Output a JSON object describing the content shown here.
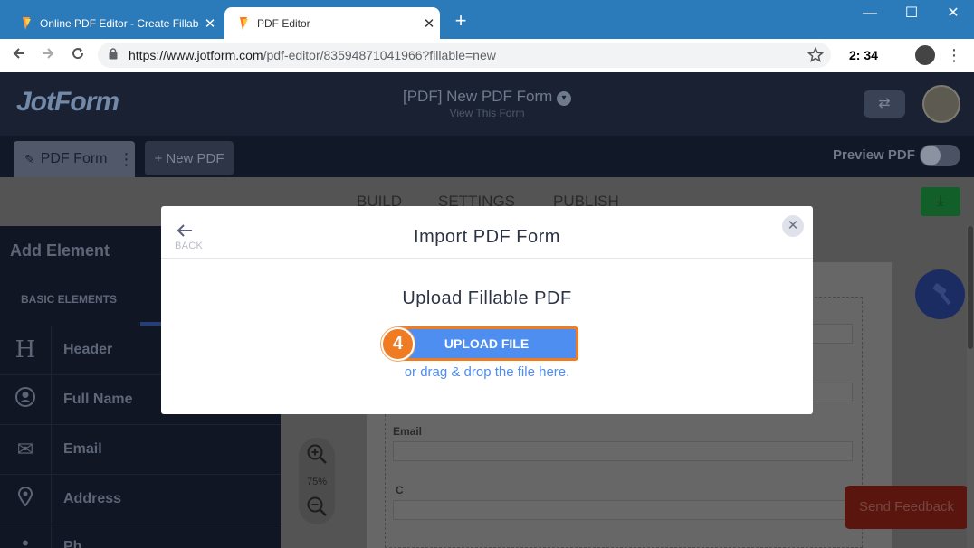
{
  "browser": {
    "tabs": [
      {
        "title": "Online PDF Editor - Create Fillabl",
        "close": "✕"
      },
      {
        "title": "PDF Editor",
        "close": "✕"
      }
    ],
    "new_tab": "+",
    "window_controls": {
      "minimize": "—",
      "maximize": "☐",
      "close": "✕"
    },
    "url_host": "https://www.jotform.com",
    "url_path": "/pdf-editor/83594871041966?fillable=new",
    "timer": "2:  34"
  },
  "app": {
    "logo": "JotForm",
    "form_title": "[PDF] New PDF Form",
    "form_subtitle": "View This Form",
    "tabs": {
      "pdf_form": "PDF Form",
      "new_pdf": "+ New PDF"
    },
    "preview_label": "Preview PDF",
    "nav": [
      "BUILD",
      "SETTINGS",
      "PUBLISH"
    ],
    "sidebar": {
      "title": "Add Element",
      "section": "BASIC ELEMENTS",
      "items": [
        {
          "icon": "H",
          "label": "Header"
        },
        {
          "icon": "👤",
          "label": "Full Name"
        },
        {
          "icon": "✉",
          "label": "Email"
        },
        {
          "icon": "⌖",
          "label": "Address"
        },
        {
          "icon": "•",
          "label": "Ph"
        }
      ]
    },
    "paper_labels": [
      "Email",
      "C"
    ],
    "zoom": "75%",
    "feedback": "Send Feedback"
  },
  "modal": {
    "back": "BACK",
    "title": "Import PDF Form",
    "close": "✕",
    "subtitle": "Upload Fillable PDF",
    "upload_button": "UPLOAD FILE",
    "step": "4",
    "drag_text": "or drag & drop the file here."
  },
  "colors": {
    "chrome_blue": "#2b7ab9",
    "upload_blue": "#4f8ef1",
    "step_orange": "#ef7b22"
  }
}
